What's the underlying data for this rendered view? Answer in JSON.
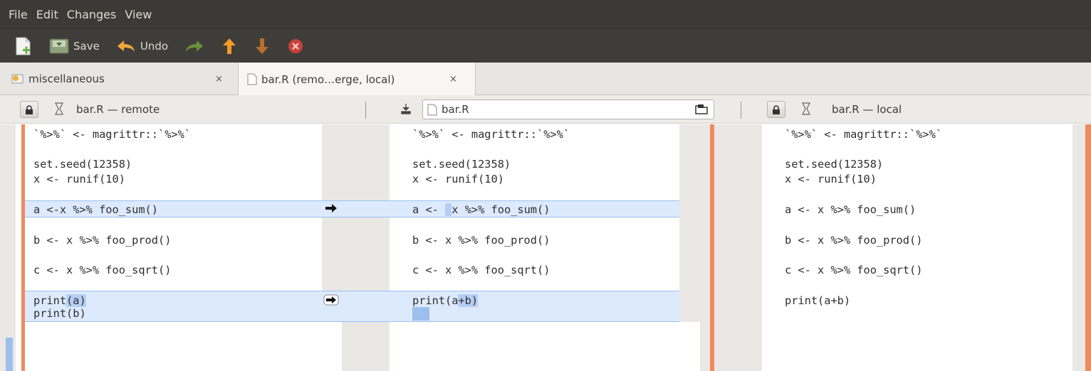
{
  "menu": [
    "File",
    "Edit",
    "Changes",
    "View"
  ],
  "toolbar": {
    "save_label": "Save",
    "undo_label": "Undo"
  },
  "tabs": [
    {
      "label": "miscellaneous",
      "close": "×"
    },
    {
      "label": "bar.R (remo…erge, local)",
      "close": "×"
    }
  ],
  "panes": {
    "left_title": "bar.R — remote",
    "middle_file": "bar.R",
    "right_title": "bar.R — local"
  },
  "left_lines": {
    "l1": "`%>%` <- magrittr::`%>%`",
    "l2": "set.seed(12358)",
    "l3": "x <- runif(10)",
    "l4": "a <-x %>% foo_sum()",
    "l5": "b <- x %>% foo_prod()",
    "l6": "c <- x %>% foo_sqrt()",
    "l7a": "print",
    "l7b": "(a)",
    "l8": "print(b)"
  },
  "middle_lines": {
    "l1": "`%>%` <- magrittr::`%>%`",
    "l2": "set.seed(12358)",
    "l3": "x <- runif(10)",
    "l4a": "a <- ",
    "l4b": " ",
    "l4c": "x %>% foo_sum()",
    "l5": "b <- x %>% foo_prod()",
    "l6": "c <- x %>% foo_sqrt()",
    "l7a": "print(a",
    "l7b": "+b)"
  },
  "right_lines": {
    "l1": "`%>%` <- magrittr::`%>%`",
    "l2": "set.seed(12358)",
    "l3": "x <- runif(10)",
    "l4": "a <- x %>% foo_sum()",
    "l5": "b <- x %>% foo_prod()",
    "l6": "c <- x %>% foo_sqrt()",
    "l7": "print(a+b)"
  },
  "colors": {
    "chrome_dark": "#3b3a36",
    "chunk_bg": "#ddeafe",
    "chunk_border": "#9dbfee",
    "orange_bar": "#f08a5d"
  }
}
